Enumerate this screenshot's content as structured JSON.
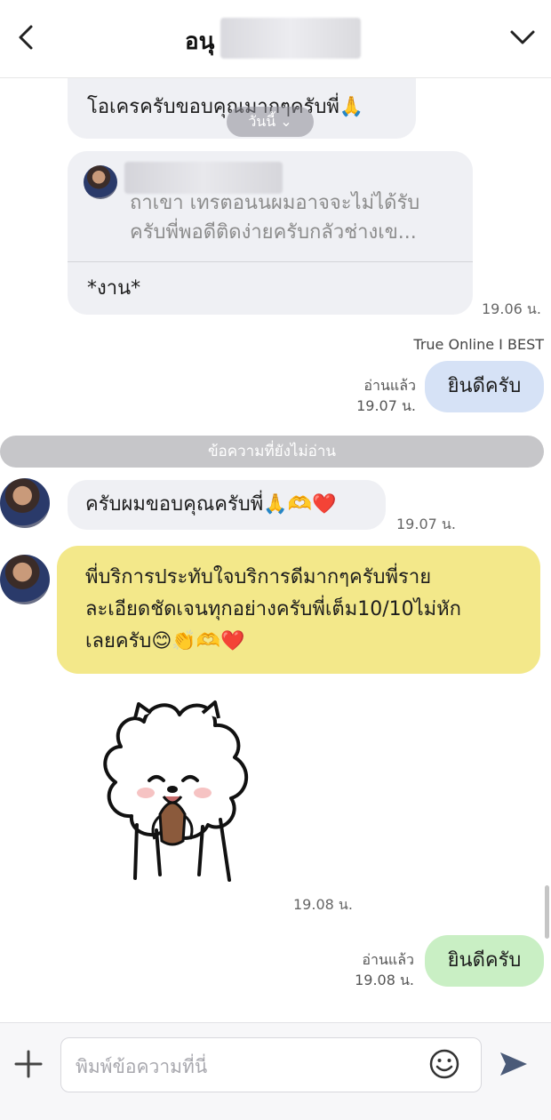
{
  "header": {
    "title": "อนุ"
  },
  "messages": {
    "m1_text": "โอเครครับขอบคุณมากๆครับพี่🙏",
    "jump_pill": "วันนี้ ⌄",
    "reply_quote_line1": "ถาเขา เทรตอนนผมอาจจะไม่ได้รับ",
    "reply_quote_line2": "ครับพี่พอดีติดง่ายครับกลัวช่างเข...",
    "reply_text": "*งาน*",
    "reply_time": "19.06 น.",
    "sender_label": "True Online I BEST",
    "out1_text": "ยินดีครับ",
    "out1_read": "อ่านแล้ว",
    "out1_time": "19.07 น.",
    "unread_bar": "ข้อความที่ยังไม่อ่าน",
    "in2_text": "ครับผมขอบคุณครับพี่🙏🫶❤️",
    "in2_time": "19.07 น.",
    "in3_line1": "พี่บริการประทับใจบริการดีมากๆครับพี่ราย",
    "in3_line2": "ละเอียดชัดเจนทุกอย่างครับพี่เต็ม10/10ไม่หัก",
    "in3_line3": "เลยครับ😊👏🫶❤️",
    "sticker_time": "19.08 น.",
    "out2_text": "ยินดีครับ",
    "out2_read": "อ่านแล้ว",
    "out2_time": "19.08 น."
  },
  "input": {
    "placeholder": "พิมพ์ข้อความที่นี่"
  },
  "icons": {
    "back": "chevron-left-icon",
    "menu": "chevron-down-icon",
    "plus": "plus-icon",
    "emoji": "smiley-icon",
    "send": "send-icon"
  },
  "colors": {
    "incoming_bubble": "#eff0f4",
    "outgoing_bubble": "#d6e2f6",
    "outgoing_bubble_green": "#c9efc4",
    "highlight_bubble": "#f3e88a",
    "send_icon": "#4a5a78"
  }
}
